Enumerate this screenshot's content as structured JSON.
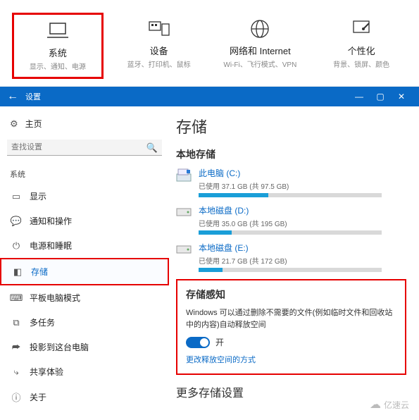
{
  "categories": [
    {
      "title": "系统",
      "sub": "显示、通知、电源"
    },
    {
      "title": "设备",
      "sub": "蓝牙、打印机、鼠标"
    },
    {
      "title": "网络和 Internet",
      "sub": "Wi-Fi、飞行模式、VPN"
    },
    {
      "title": "个性化",
      "sub": "背景、锁屏、颜色"
    }
  ],
  "window": {
    "title": "设置",
    "home": "主页",
    "search_placeholder": "查找设置"
  },
  "sidebar": {
    "section": "系统",
    "items": [
      {
        "label": "显示"
      },
      {
        "label": "通知和操作"
      },
      {
        "label": "电源和睡眠"
      },
      {
        "label": "存储"
      },
      {
        "label": "平板电脑模式"
      },
      {
        "label": "多任务"
      },
      {
        "label": "投影到这台电脑"
      },
      {
        "label": "共享体验"
      },
      {
        "label": "关于"
      }
    ]
  },
  "content": {
    "heading": "存储",
    "local_heading": "本地存储",
    "drives": [
      {
        "name": "此电脑 (C:)",
        "usage": "已使用 37.1 GB (共 97.5 GB)",
        "pct": 38
      },
      {
        "name": "本地磁盘 (D:)",
        "usage": "已使用 35.0 GB (共 195 GB)",
        "pct": 18
      },
      {
        "name": "本地磁盘 (E:)",
        "usage": "已使用 21.7 GB (共 172 GB)",
        "pct": 13
      }
    ],
    "sense": {
      "heading": "存储感知",
      "desc": "Windows 可以通过删除不需要的文件(例如临时文件和回收站中的内容)自动释放空间",
      "toggle_label": "开",
      "link": "更改释放空间的方式"
    },
    "more_heading": "更多存储设置"
  },
  "watermark": "亿速云"
}
